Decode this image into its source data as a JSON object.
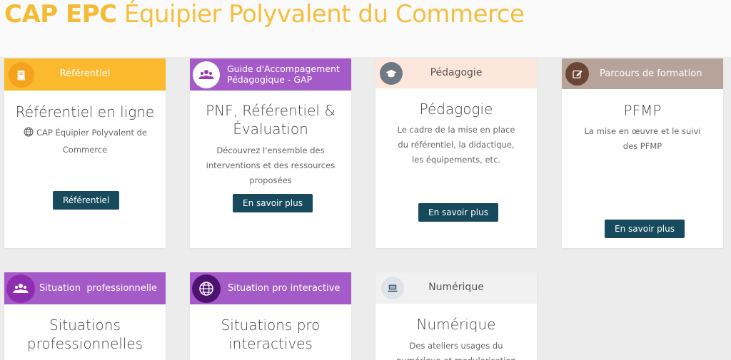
{
  "page": {
    "title_bold": "CAP EPC",
    "title_rest": " Équipier Polyvalent du Commerce"
  },
  "cards": [
    {
      "header": "Référentiel",
      "title": "Référentiel en ligne",
      "desc": "CAP Équipier Polyvalent de Commerce",
      "button": "Référentiel",
      "icon": "book-icon"
    },
    {
      "header_l1": "Guide d'Accompagement",
      "header_l2": "Pédagogique - GAP",
      "title_l1": "PNF, Référentiel &",
      "title_l2": "Évaluation",
      "desc": "Découvrez l'ensemble des interventions et des ressources proposées",
      "button": "En savoir plus",
      "icon": "users-icon"
    },
    {
      "header": "Pédagogie",
      "title": "Pédagogie",
      "desc": "Le cadre de la mise en place du référentiel, la didactique, les équipements, etc.",
      "button": "En savoir plus",
      "icon": "graduation-cap-icon"
    },
    {
      "header": "Parcours de formation",
      "title": "PFMP",
      "desc": "La mise en œuvre et le suivi des PFMP",
      "button": "En savoir plus",
      "icon": "edit-icon"
    },
    {
      "header": "Situation  professionnelle",
      "title_l1": "Situations",
      "title_l2": "professionnelles",
      "icon": "users-icon"
    },
    {
      "header": "Situation pro interactive",
      "title_l1": "Situations pro",
      "title_l2": "interactives",
      "icon": "globe-icon"
    },
    {
      "header": "Numérique",
      "title": "Numérique",
      "desc": "Des ateliers usages du numérique et modularisation",
      "icon": "laptop-icon"
    }
  ],
  "colors": {
    "yellow": "#fbb92d",
    "purple": "#a45bc8",
    "peach": "#fde6dc",
    "taupe": "#b7a399",
    "grey": "#f1f1f1",
    "button": "#164a5c",
    "title": "#f4bc34"
  }
}
